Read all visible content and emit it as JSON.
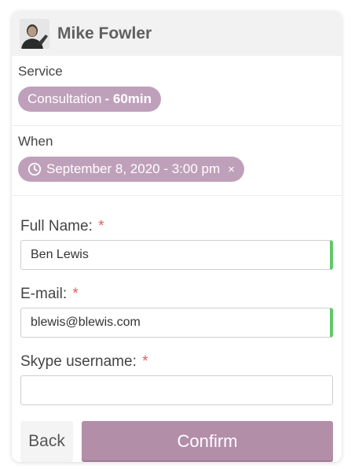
{
  "provider": {
    "name": "Mike Fowler",
    "avatar_icon": "person-photo"
  },
  "service": {
    "label": "Service",
    "name": "Consultation",
    "duration": "- 60min"
  },
  "when": {
    "label": "When",
    "datetime": "September 8, 2020 - 3:00 pm",
    "remove_glyph": "×",
    "icon": "clock-icon"
  },
  "form": {
    "required_mark": "*",
    "fields": [
      {
        "label": "Full Name:",
        "value": "Ben Lewis",
        "valid": true
      },
      {
        "label": "E-mail:",
        "value": "blewis@blewis.com",
        "valid": true
      },
      {
        "label": "Skype username:",
        "value": "",
        "valid": false
      }
    ]
  },
  "actions": {
    "back_label": "Back",
    "confirm_label": "Confirm"
  },
  "colors": {
    "accent": "#b28ea9",
    "pill": "#bfa0ba",
    "valid": "#5fc96b",
    "required": "#e0605a",
    "header_bg": "#f2f2f2"
  }
}
